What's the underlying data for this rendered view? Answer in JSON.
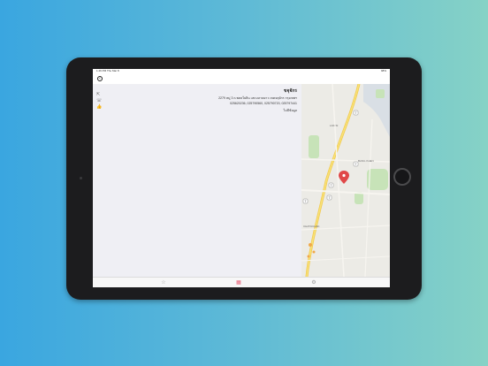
{
  "status_bar": {
    "time": "1:46 PM  Thu Mar 8",
    "battery": "98%"
  },
  "place": {
    "name": "ขจุจักร",
    "address": "2279 หมู่ 3 ถ.พหลโยธิน แขวงลาดยาว เขตจตุจักร กรุงเทพฯ",
    "phones": "025620236, 025790560, 025790720, 025797441",
    "hours": "ไม่มีข้อมูล"
  },
  "map": {
    "labels": [
      "LAK SI",
      "BANG KHEN",
      "CHATUCHAK"
    ],
    "shields": [
      "7",
      "7",
      "7",
      "7",
      "7"
    ],
    "pin_color": "#e04848"
  },
  "icons": {
    "back": "back-arrow-icon",
    "side": [
      "directions-icon",
      "phone-icon",
      "thumbs-up-icon"
    ],
    "tabs": [
      "star-icon",
      "grid-icon",
      "gear-icon"
    ]
  },
  "colors": {
    "accent": "#e85b72",
    "background_start": "#3aa6e0",
    "background_end": "#86d2c6"
  }
}
